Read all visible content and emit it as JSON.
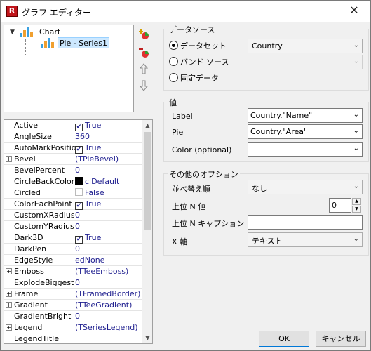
{
  "window": {
    "title": "グラフ エディター",
    "app_icon": "R",
    "close": "✕"
  },
  "tree": {
    "root": "Chart",
    "child": "Pie - Series1"
  },
  "properties": [
    {
      "name": "Active",
      "value": "True",
      "kind": "check",
      "checked": true
    },
    {
      "name": "AngleSize",
      "value": "360",
      "kind": "text"
    },
    {
      "name": "AutoMarkPosition",
      "value": "True",
      "kind": "check",
      "checked": true
    },
    {
      "name": "Bevel",
      "value": "(TPieBevel)",
      "kind": "expand"
    },
    {
      "name": "BevelPercent",
      "value": "0",
      "kind": "text"
    },
    {
      "name": "CircleBackColor",
      "value": "clDefault",
      "kind": "color"
    },
    {
      "name": "Circled",
      "value": "False",
      "kind": "check",
      "checked": false
    },
    {
      "name": "ColorEachPoint",
      "value": "True",
      "kind": "check",
      "checked": true
    },
    {
      "name": "CustomXRadius",
      "value": "0",
      "kind": "text"
    },
    {
      "name": "CustomYRadius",
      "value": "0",
      "kind": "text"
    },
    {
      "name": "Dark3D",
      "value": "True",
      "kind": "check",
      "checked": true
    },
    {
      "name": "DarkPen",
      "value": "0",
      "kind": "text"
    },
    {
      "name": "EdgeStyle",
      "value": "edNone",
      "kind": "text"
    },
    {
      "name": "Emboss",
      "value": "(TTeeEmboss)",
      "kind": "expand"
    },
    {
      "name": "ExplodeBiggest",
      "value": "0",
      "kind": "text"
    },
    {
      "name": "Frame",
      "value": "(TFramedBorder)",
      "kind": "expand"
    },
    {
      "name": "Gradient",
      "value": "(TTeeGradient)",
      "kind": "expand"
    },
    {
      "name": "GradientBright",
      "value": "0",
      "kind": "text"
    },
    {
      "name": "Legend",
      "value": "(TSeriesLegend)",
      "kind": "expand"
    },
    {
      "name": "LegendTitle",
      "value": "",
      "kind": "text"
    }
  ],
  "datasource": {
    "group_label": "データソース",
    "options": [
      "データセット",
      "バンド ソース",
      "固定データ"
    ],
    "selected_index": 0,
    "dataset_value": "Country",
    "band_value": ""
  },
  "values": {
    "group_label": "値",
    "label_label": "Label",
    "label_value": "Country.\"Name\"",
    "pie_label": "Pie",
    "pie_value": "Country.\"Area\"",
    "color_label": "Color (optional)",
    "color_value": ""
  },
  "other": {
    "group_label": "その他のオプション",
    "sort_label": "並べ替え順",
    "sort_value": "なし",
    "topn_label": "上位 N 値",
    "topn_value": "0",
    "topn_caption_label": "上位 N キャプション",
    "topn_caption_value": "",
    "xaxis_label": "X 軸",
    "xaxis_value": "テキスト"
  },
  "buttons": {
    "ok": "OK",
    "cancel": "キャンセル"
  },
  "icons": {
    "chevron": "▾",
    "expand": "+",
    "check": "✔",
    "add": "add-series-icon",
    "remove": "remove-series-icon",
    "up": "move-up-icon",
    "down": "move-down-icon"
  }
}
